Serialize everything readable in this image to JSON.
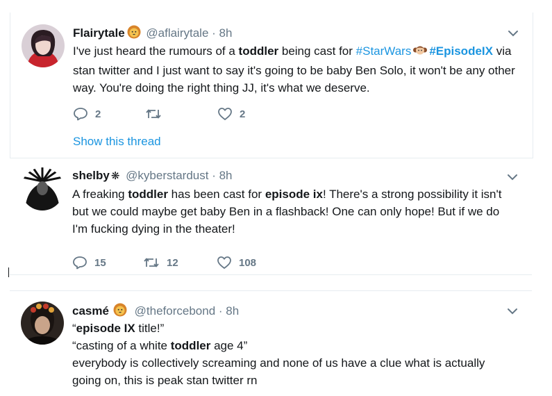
{
  "tweets": [
    {
      "name": "Flairytale",
      "handle": "@aflairytale",
      "time": "· 8h",
      "text_1": "I've just heard the rumours of a ",
      "bold_1": "toddler",
      "text_2": " being cast for ",
      "hashtag_1": "#StarWars",
      "hashtag_2": "#EpisodeIX",
      "text_3": " via stan twitter and I just want to say it's going to be baby Ben Solo, it won't be any other way. You're doing the right thing JJ, it's what we deserve.",
      "replies": "2",
      "retweets": "",
      "likes": "2",
      "show_thread": "Show this thread"
    },
    {
      "name": "shelby",
      "handle": "@kyberstardust",
      "time": "· 8h",
      "text_1": "A freaking ",
      "bold_1": "toddler",
      "text_2": " has been cast for ",
      "bold_2": "episode ix",
      "text_3": "! There's a strong possibility it isn't but we could maybe get baby Ben in a flashback! One can only hope! But if we do I'm fucking dying in the theater!",
      "replies": "15",
      "retweets": "12",
      "likes": "108"
    },
    {
      "name": "casmé",
      "handle": "@theforcebond",
      "time": "· 8h",
      "line1_pre": "“",
      "line1_bold": "episode IX",
      "line1_post": " title!”",
      "line2_pre": "“casting of a white ",
      "line2_bold": "toddler",
      "line2_post": " age 4”",
      "line3": "everybody is collectively screaming and none of us have a clue what is actually going on, this is peak stan twitter rn"
    }
  ],
  "icons": {
    "lion_emoji": "lion-emoji",
    "leia_emoji": "leia-emoji",
    "sparkle": "❋",
    "chevron": "chevron-down-icon",
    "reply": "reply-icon",
    "retweet": "retweet-icon",
    "like": "heart-icon"
  },
  "colors": {
    "link": "#1b95e0",
    "muted": "#657786",
    "text": "#14171a",
    "border": "#e6ecf0"
  }
}
